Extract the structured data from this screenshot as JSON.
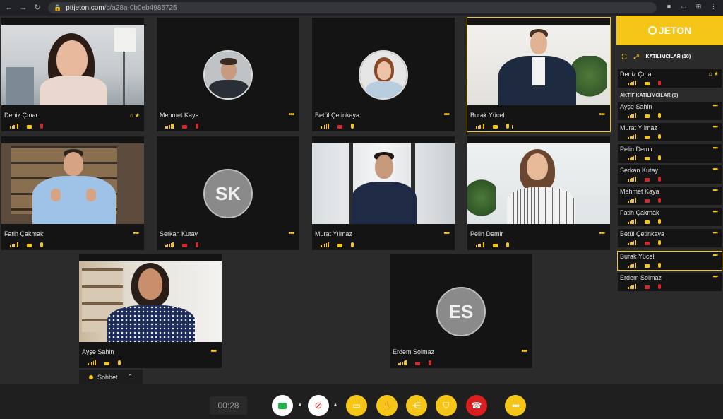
{
  "browser": {
    "url_host": "pttjeton.com",
    "url_path": "/c/a28a-0b0eb4985725"
  },
  "brand": {
    "name": "JETON",
    "accent": "#f5c518"
  },
  "participants_header": "KATILIMCILAR (10)",
  "active_section": "AKTİF KATILIMCILAR (9)",
  "tiles": [
    {
      "name": "Deniz Çınar",
      "camera": "on",
      "mic": "off",
      "host": true
    },
    {
      "name": "Mehmet Kaya",
      "camera": "off",
      "mic": "off"
    },
    {
      "name": "Betül Çetinkaya",
      "camera": "off",
      "mic": "on"
    },
    {
      "name": "Burak Yücel",
      "camera": "on",
      "mic": "on",
      "speaking": true
    },
    {
      "name": "Fatih Çakmak",
      "camera": "on",
      "mic": "on"
    },
    {
      "name": "Serkan Kutay",
      "initials": "SK",
      "camera": "off",
      "mic": "off"
    },
    {
      "name": "Murat Yılmaz",
      "camera": "on",
      "mic": "on"
    },
    {
      "name": "Pelin Demir",
      "camera": "on",
      "mic": "on"
    },
    {
      "name": "Ayşe Şahin",
      "camera": "on",
      "mic": "on"
    },
    {
      "name": "Erdem Solmaz",
      "initials": "ES",
      "camera": "off",
      "mic": "off"
    }
  ],
  "sidebar": {
    "host": {
      "name": "Deniz Çınar",
      "camera": "on",
      "mic": "off"
    },
    "active": [
      {
        "name": "Ayşe Şahin",
        "camera": "on",
        "mic": "on"
      },
      {
        "name": "Murat Yılmaz",
        "camera": "on",
        "mic": "on"
      },
      {
        "name": "Pelin Demir",
        "camera": "on",
        "mic": "on"
      },
      {
        "name": "Serkan Kutay",
        "camera": "off",
        "mic": "off"
      },
      {
        "name": "Mehmet Kaya",
        "camera": "off",
        "mic": "off"
      },
      {
        "name": "Fatih Çakmak",
        "camera": "on",
        "mic": "on"
      },
      {
        "name": "Betül Çetinkaya",
        "camera": "off",
        "mic": "on"
      },
      {
        "name": "Burak Yücel",
        "camera": "on",
        "mic": "on",
        "speaking": true
      },
      {
        "name": "Erdem Solmaz",
        "camera": "off",
        "mic": "off"
      }
    ]
  },
  "chat_label": "Sohbet",
  "timer": "00:28",
  "more_glyph": "•••",
  "icons": {
    "host_badges": "home-icon star-icon",
    "camera": "camera-icon",
    "mic_off": "mic-off-icon",
    "screen_share": "screen-share-icon",
    "raise_hand": "hand-icon",
    "share": "share-icon",
    "security": "shield-icon",
    "hangup": "phone-hangup-icon",
    "more": "more-icon"
  }
}
